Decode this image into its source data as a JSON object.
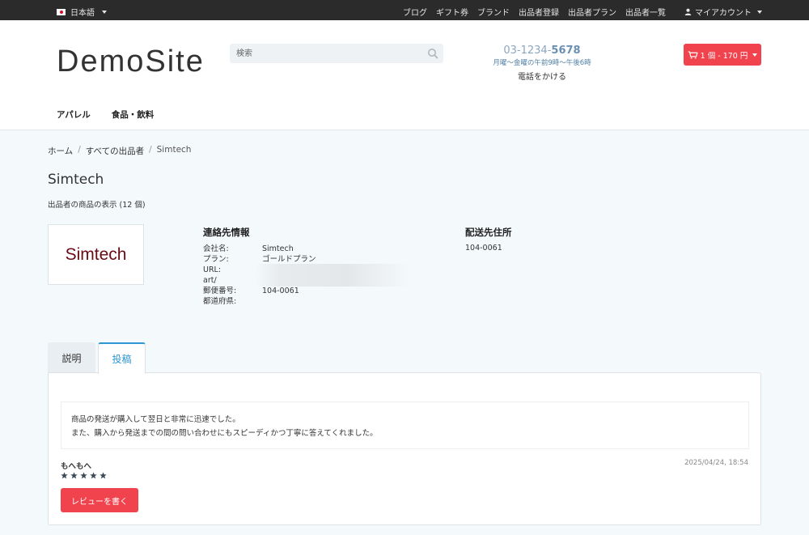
{
  "topbar": {
    "language": "日本語",
    "nav": [
      "ブログ",
      "ギフト券",
      "ブランド",
      "出品者登録",
      "出品者プラン",
      "出品者一覧"
    ],
    "account": "マイアカウント"
  },
  "header": {
    "logo": "DemoSite",
    "search_placeholder": "検索",
    "phone_prefix": "03-1234-",
    "phone_suffix": "5678",
    "hours": "月曜〜金曜の午前9時〜午後6時",
    "call_label": "電話をかける",
    "cart_label": "1 個 - 170 円"
  },
  "menu": [
    "アパレル",
    "食品・飲料"
  ],
  "breadcrumb": [
    "ホーム",
    "すべての出品者",
    "Simtech"
  ],
  "vendor": {
    "title": "Simtech",
    "products_count": "出品者の商品の表示 (12 個)",
    "logo_text": "Simtech"
  },
  "contact": {
    "heading": "連絡先情報",
    "rows": [
      {
        "label": "会社名:",
        "value": "Simtech"
      },
      {
        "label": "プラン:",
        "value": "ゴールドプラン"
      },
      {
        "label": "URL:",
        "value": ""
      },
      {
        "label": "art/",
        "value": ""
      },
      {
        "label": "郵便番号:",
        "value": "104-0061"
      },
      {
        "label": "都道府県:",
        "value": ""
      }
    ]
  },
  "shipping": {
    "heading": "配送先住所",
    "zip": "104-0061"
  },
  "tabs": {
    "description": "説明",
    "posts": "投稿"
  },
  "review": {
    "line1": "商品の発送が購入して翌日と非常に迅速でした。",
    "line2": "また、購入から発送までの間の問い合わせにもスピーディかつ丁寧に答えてくれました。",
    "author": "もへもへ",
    "date": "2025/04/24, 18:54",
    "rating": 5,
    "write_button": "レビューを書く"
  },
  "colors": {
    "accent_red": "#f0434d",
    "link_blue": "#2d97d3",
    "topbar_bg": "#2b2b2b"
  }
}
